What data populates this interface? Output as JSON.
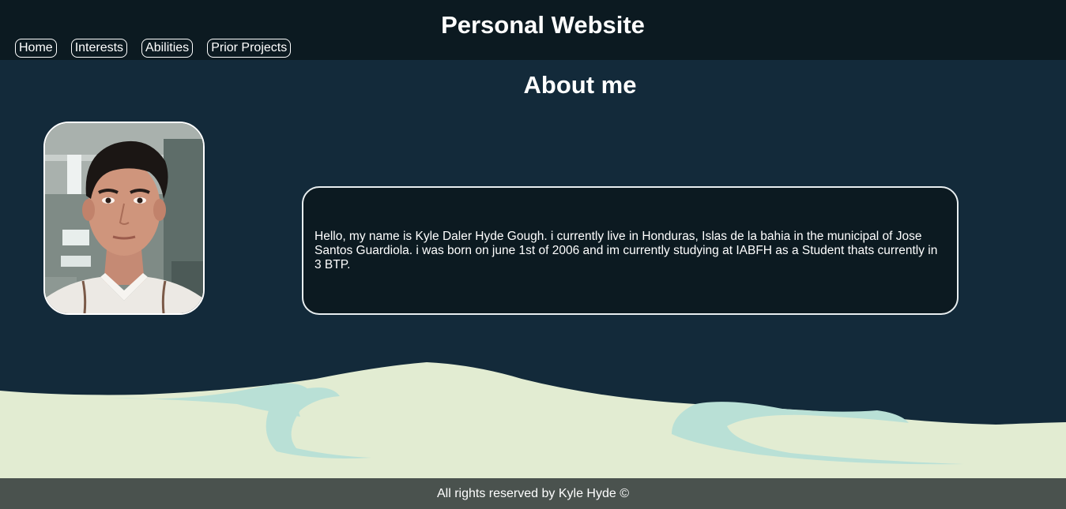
{
  "header": {
    "title": "Personal Website",
    "nav": [
      {
        "label": "Home"
      },
      {
        "label": "Interests"
      },
      {
        "label": "Abilities"
      },
      {
        "label": "Prior Projects"
      }
    ]
  },
  "main": {
    "section_title": "About me",
    "about_text": "Hello, my name is Kyle Daler Hyde Gough. i currently live in Honduras, Islas de la bahia in the municipal of Jose Santos Guardiola. i was born on june 1st of 2006 and im currently studying at IABFH as a Student thats currently in 3 BTP."
  },
  "footer": {
    "text": "All rights reserved by Kyle Hyde ©"
  },
  "colors": {
    "background": "#132a3a",
    "header_bg": "#0c1a21",
    "footer_bg": "#4a524e",
    "sand": "#e2ecd2",
    "water": "#b9e0d6"
  }
}
